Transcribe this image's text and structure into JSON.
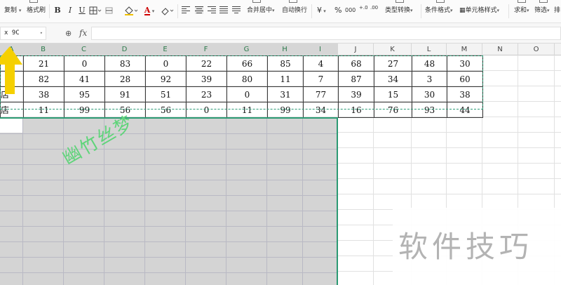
{
  "ribbon": {
    "copy_label": "复制",
    "format_painter_label": "格式刷",
    "font_bold": "B",
    "font_italic": "I",
    "font_underline": "U",
    "merge_center_label": "合并居中",
    "wrap_text_label": "自动换行",
    "currency_symbol": "¥",
    "percent_symbol": "%",
    "thousands_symbol": "000",
    "increase_decimal_symbol": "+.0",
    "decrease_decimal_symbol": ".00",
    "type_convert_label": "类型转换",
    "conditional_format_label": "条件格式",
    "cell_style_label": "单元格样式",
    "sum_label": "求和",
    "filter_label": "筛选",
    "sort_label": "排"
  },
  "formula_bar": {
    "name_box": "x 9C",
    "fx_label": "fx",
    "formula_value": ""
  },
  "columns": [
    "A",
    "B",
    "C",
    "D",
    "E",
    "F",
    "G",
    "H",
    "I",
    "J",
    "K",
    "L",
    "M",
    "N",
    "O"
  ],
  "table": {
    "rows": [
      {
        "label": "",
        "values": [
          "21",
          "0",
          "83",
          "0",
          "22",
          "66",
          "85",
          "4",
          "68",
          "27",
          "48",
          "30"
        ]
      },
      {
        "label": "",
        "values": [
          "82",
          "41",
          "28",
          "92",
          "39",
          "80",
          "11",
          "7",
          "87",
          "34",
          "3",
          "60"
        ]
      },
      {
        "label": "店",
        "values": [
          "38",
          "95",
          "91",
          "51",
          "23",
          "0",
          "31",
          "77",
          "39",
          "15",
          "30",
          "38"
        ]
      },
      {
        "label": "店",
        "values": [
          "11",
          "99",
          "56",
          "56",
          "0",
          "11",
          "99",
          "34",
          "16",
          "76",
          "93",
          "44"
        ]
      }
    ]
  },
  "watermark_handwritten": "幽竹丝梦",
  "watermark_site": "软件技巧",
  "colors": {
    "selection_border": "#2b9a73",
    "selection_fill": "#d4d4d4",
    "arrow": "#f5d000",
    "header_text": "#2c7a4b"
  }
}
